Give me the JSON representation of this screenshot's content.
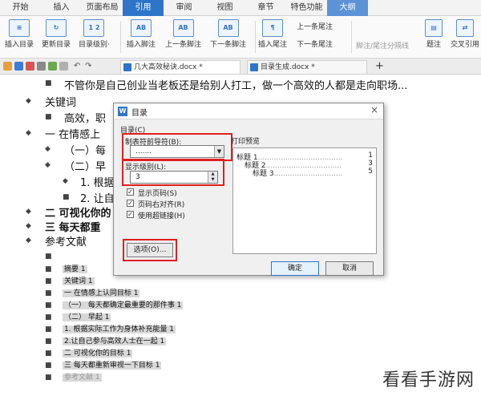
{
  "ribbon_tabs": [
    "开始",
    "插入",
    "页面布局",
    "引用",
    "审阅",
    "视图",
    "章节",
    "特色功能",
    "大纲"
  ],
  "active_tab_index": 3,
  "ribbon": {
    "insert_toc": "插入目录",
    "update_toc": "更新目录",
    "toc_level": "目录级别·",
    "insert_footnote": "插入脚注",
    "prev_footnote": "上一条脚注",
    "next_footnote": "下一条脚注",
    "insert_endnote": "插入尾注",
    "prev_endnote": "上一条尾注",
    "next_endnote": "下一条尾注",
    "footnote_separator": "脚注/尾注分隔线",
    "title_label": "题注",
    "cross_ref": "交叉引用",
    "icon_ab1": "AB",
    "icon_ab2": "AB",
    "icon_ab3": "AB"
  },
  "doc_tabs": [
    {
      "label": "几大高效秘诀.docx *"
    },
    {
      "label": "目录生成.docx *"
    }
  ],
  "document": {
    "line1": "不管你是自己创业当老板还是给别人打工，做一个高效的人都是走向职场...",
    "h_keywords": "关键词",
    "keywords_body": "高效，职",
    "h_one": "一 在情感上",
    "sub1": "（一）每",
    "sub2": "（二）早",
    "sub3": "1. 根据",
    "sub4": "2. 让自",
    "h_two": "二 可视化你的",
    "h_three": "三 每天都重",
    "h_refs": "参考文献",
    "toc_lines": [
      "摘要    1",
      "关键词    1",
      "一 在情感上认同目标    1",
      "（一） 每天都确定最重要的那件事    1",
      "（二） 早起    1",
      "1. 根据实际工作为身体补充能量    1",
      "2.让自己参与高效人士在一起    1",
      "二 可视化你的目标    1",
      "三 每天都重新审视一下目标    1",
      "参考文献    1"
    ]
  },
  "dialog": {
    "title": "目录",
    "section_label": "目录(C)",
    "leader_label": "制表符前导符(B):",
    "leader_value": ".......",
    "levels_label": "显示级别(L):",
    "levels_value": "3",
    "show_page_numbers": "显示页码(S)",
    "right_align": "页码右对齐(R)",
    "use_hyperlinks": "使用超链接(H)",
    "preview_label": "打印预览",
    "preview_lines": [
      {
        "text": "标题 1",
        "page": "1"
      },
      {
        "text": "标题 2",
        "page": "3"
      },
      {
        "text": "标题 3",
        "page": "5"
      }
    ],
    "options_button": "选项(O)...",
    "ok_button": "确定",
    "cancel_button": "取消",
    "close_glyph": "×"
  },
  "watermark": "看看手游网",
  "colors": {
    "accent": "#2e75c9",
    "highlight": "#e02020",
    "toc_background": "#d9d9d9"
  }
}
